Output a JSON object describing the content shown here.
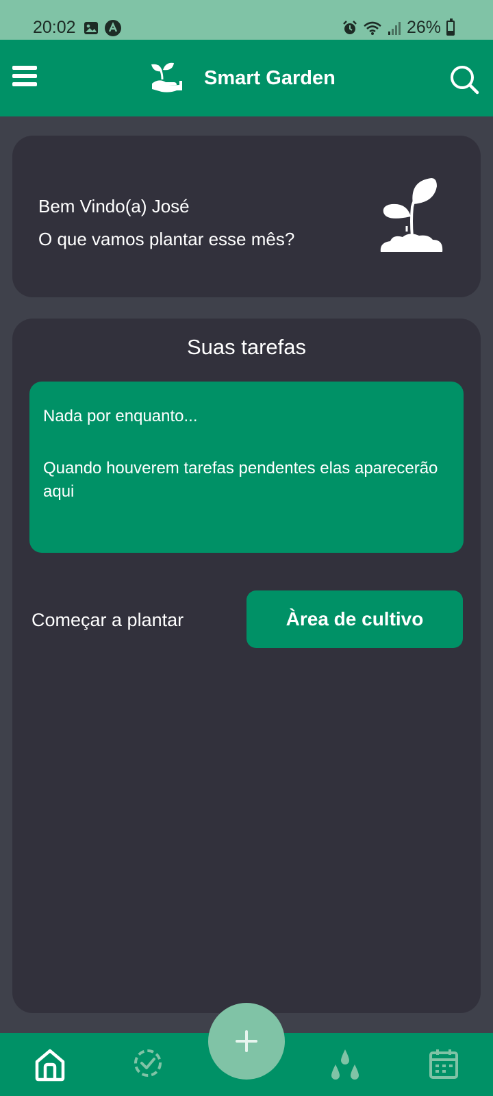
{
  "status_bar": {
    "time": "20:02",
    "battery": "26%",
    "icons": [
      "image-icon",
      "nav-app-icon",
      "alarm-icon",
      "wifi-icon",
      "signal-icon",
      "battery-icon"
    ]
  },
  "app_bar": {
    "title": "Smart Garden",
    "left_icon": "menu-icon",
    "logo_icon": "hand-plant-logo-icon",
    "right_icon": "search-icon"
  },
  "welcome": {
    "greeting": "Bem Vindo(a) José",
    "question": "O que vamos plantar esse mês?",
    "icon": "sprout-icon"
  },
  "tasks": {
    "title": "Suas tarefas",
    "empty_title": "Nada por enquanto...",
    "empty_message": "Quando houverem tarefas pendentes elas aparecerão aqui"
  },
  "cultivation": {
    "label": "Começar a plantar",
    "button": "Àrea de cultivo"
  },
  "bottom_nav": {
    "items": [
      "home-icon",
      "tasks-check-icon",
      "add-icon",
      "water-drops-icon",
      "calendar-icon"
    ]
  },
  "colors": {
    "primary": "#009166",
    "light_green": "#80C3A6",
    "background": "#3F414B",
    "card": "#32313C"
  }
}
